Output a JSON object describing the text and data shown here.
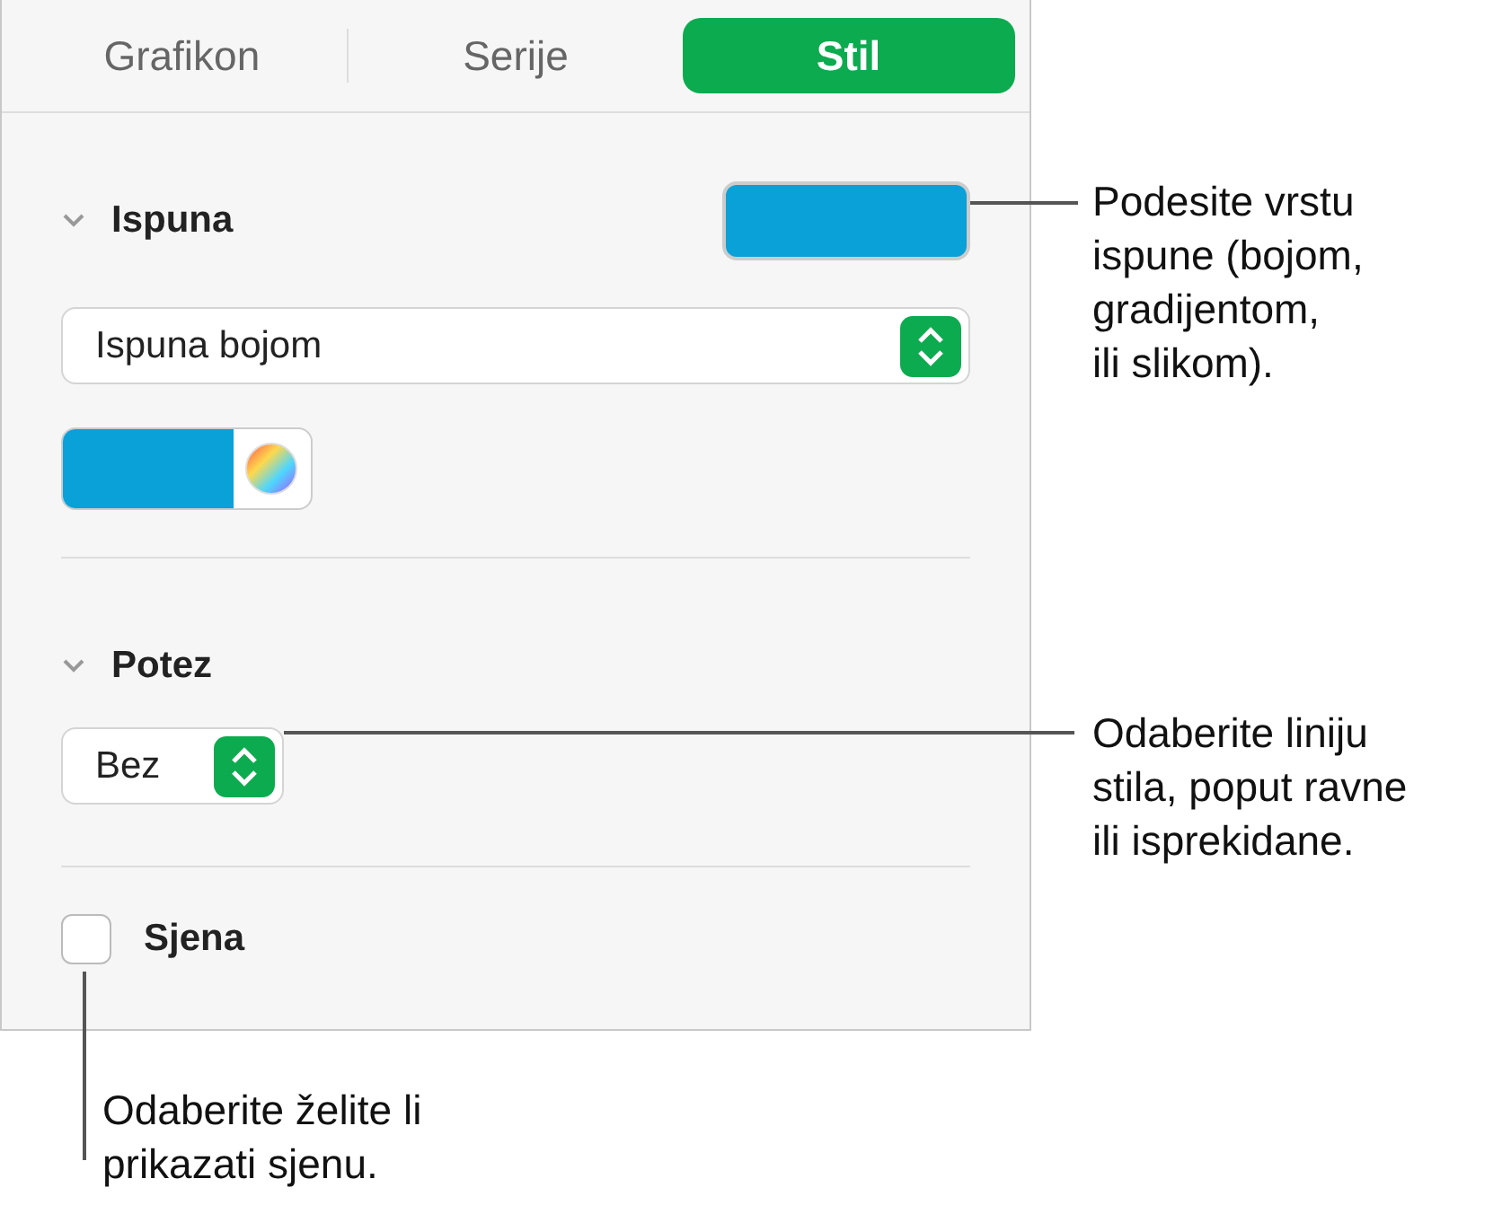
{
  "tabs": [
    {
      "label": "Grafikon",
      "selected": false
    },
    {
      "label": "Serije",
      "selected": false
    },
    {
      "label": "Stil",
      "selected": true
    }
  ],
  "fill": {
    "title": "Ispuna",
    "expanded": true,
    "fill_type": "Ispuna bojom"
  },
  "stroke": {
    "title": "Potez",
    "expanded": true,
    "value": "Bez"
  },
  "shadow": {
    "label": "Sjena",
    "checked": false
  },
  "callouts": [
    {
      "lines": [
        "Podesite vrstu",
        "ispune (bojom,",
        "gradijentom,",
        "ili slikom)."
      ]
    },
    {
      "lines": [
        "Odaberite liniju",
        "stila, poput ravne",
        "ili isprekidane."
      ]
    },
    {
      "lines": [
        "Odaberite želite li",
        "prikazati sjenu."
      ]
    }
  ]
}
